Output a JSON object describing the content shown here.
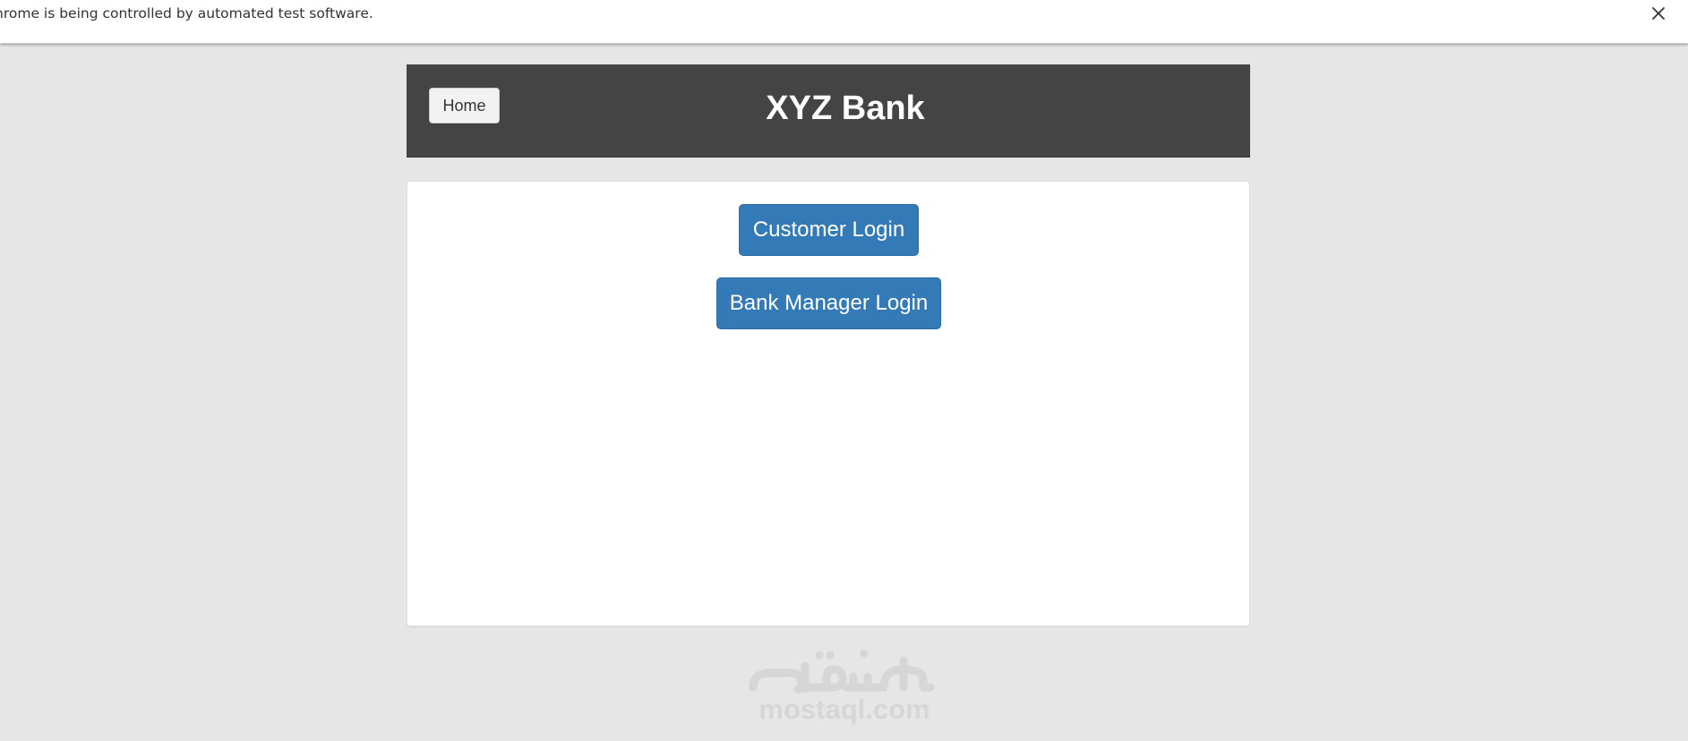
{
  "infobar": {
    "message": "hrome is being controlled by automated test software.",
    "close_icon": "close-icon"
  },
  "header": {
    "home_label": "Home",
    "title": "XYZ Bank",
    "background": "#444444"
  },
  "panel": {
    "customer_login_label": "Customer Login",
    "bank_manager_login_label": "Bank Manager Login",
    "button_color": "#337ab7"
  },
  "watermark": {
    "text": "mostaql.com",
    "logo": "mostaql-logo"
  }
}
